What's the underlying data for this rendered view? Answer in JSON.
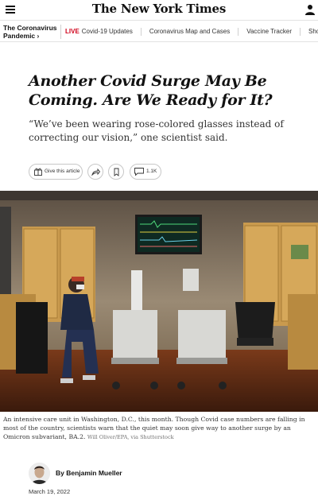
{
  "masthead": {
    "logo": "The New York Times"
  },
  "subnav": {
    "section": "The Coronavirus Pandemic ›",
    "live": "LIVE",
    "items": [
      "Covid-19 Updates",
      "Coronavirus Map and Cases",
      "Vaccine Tracker",
      "Should You Get a"
    ]
  },
  "article": {
    "headline": "Another Covid Surge May Be Coming. Are We Ready for It?",
    "summary": "“We’ve been wearing rose-colored glasses instead of correcting our vision,” one scientist said.",
    "caption": "An intensive care unit in Washington, D.C., this month. Though Covid case numbers are falling in most of the country, scientists warn that the quiet may soon give way to another surge by an Omicron subvariant, BA.2.",
    "credit": "Will Oliver/EPA, via Shutterstock",
    "byline": "By Benjamin Mueller",
    "date": "March 19, 2022"
  },
  "tools": {
    "gift_label": "Give this article",
    "comment_count": "1.1K"
  },
  "icons": {
    "menu": "menu-icon",
    "user": "user-icon",
    "gift": "gift-icon",
    "share": "share-icon",
    "bookmark": "bookmark-icon",
    "comment": "comment-icon"
  },
  "colors": {
    "live": "#d0021b",
    "text": "#121212",
    "border": "#c7c7c7"
  }
}
